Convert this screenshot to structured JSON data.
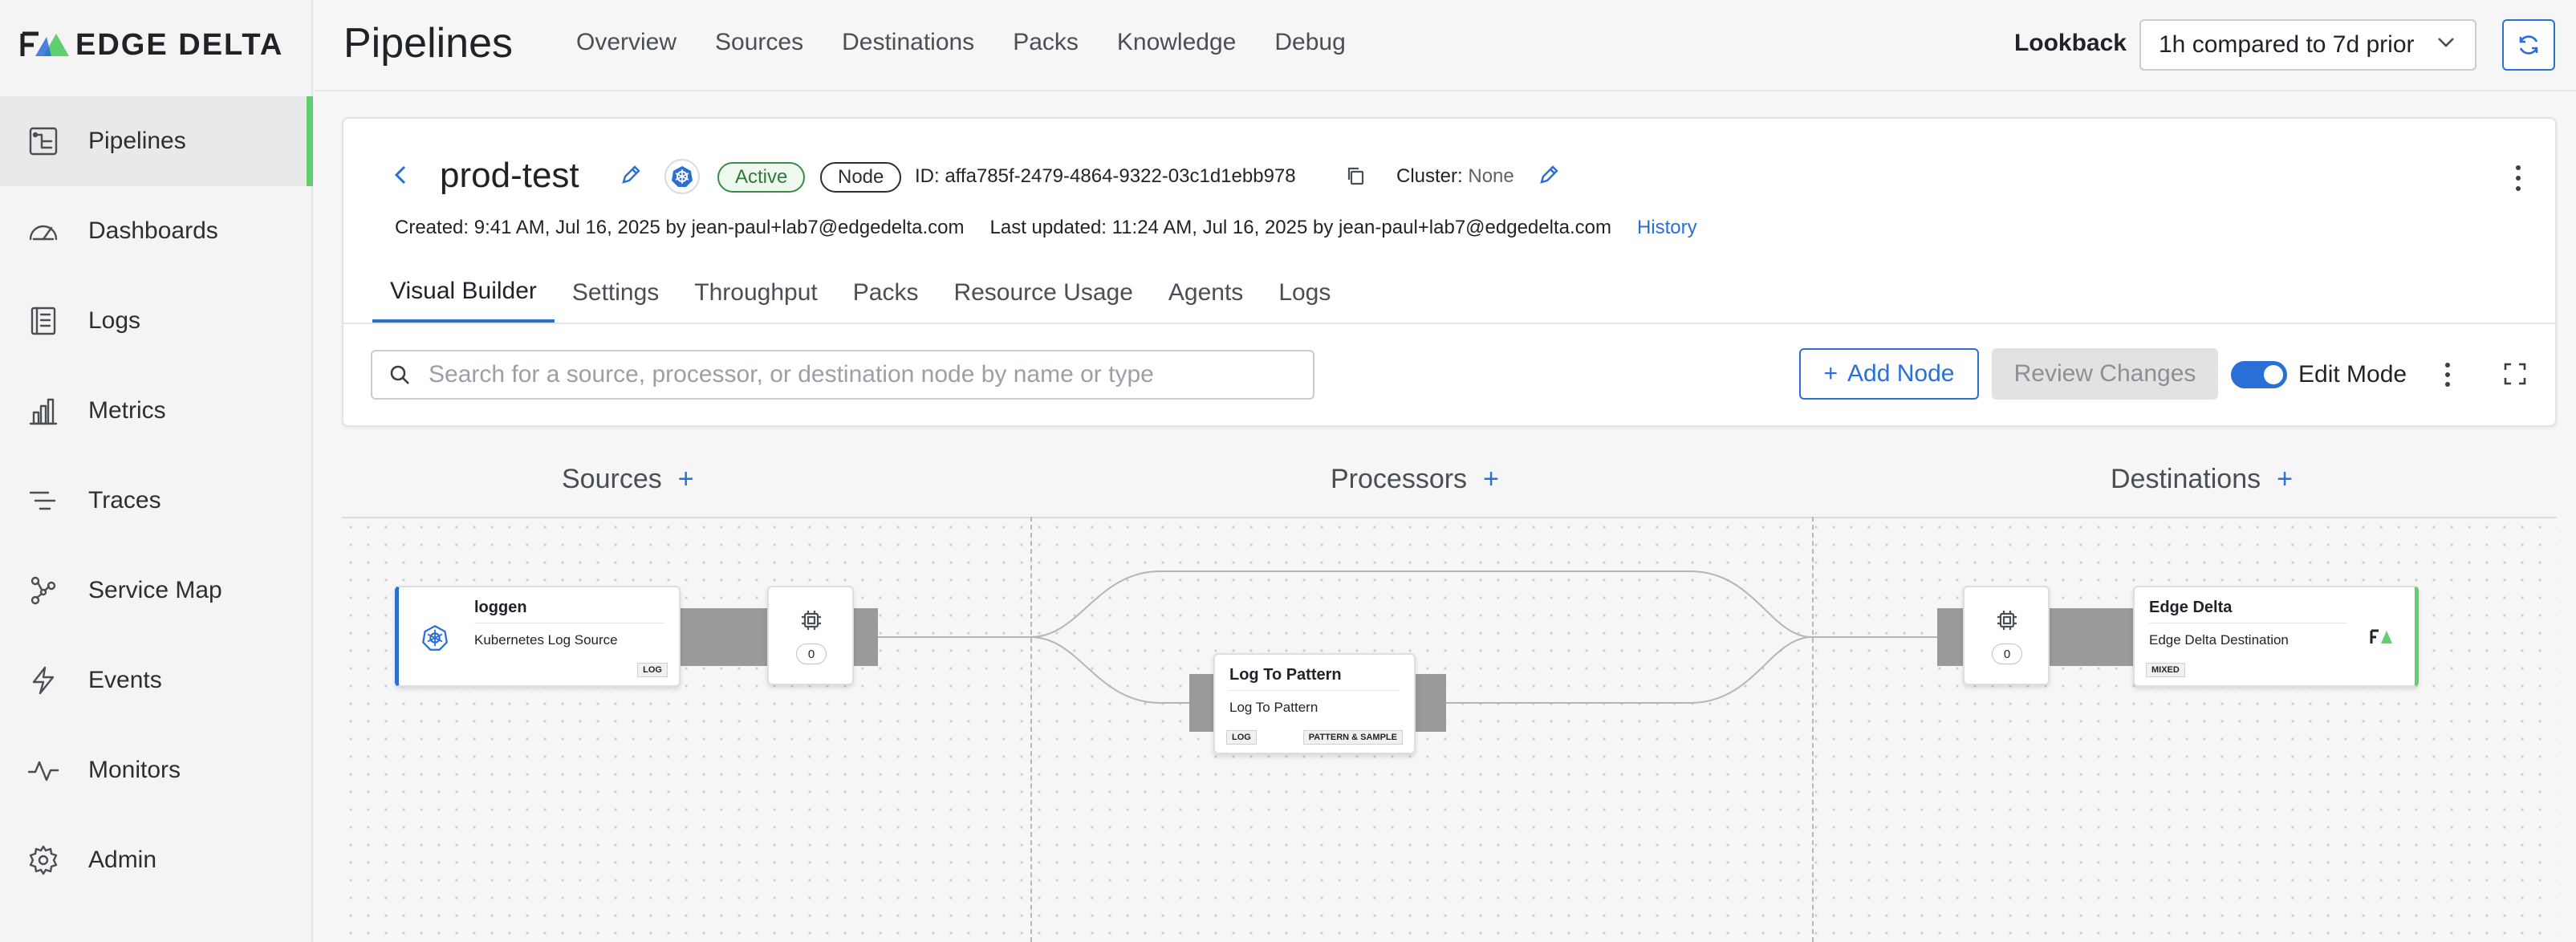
{
  "app": {
    "brand": "EDGE DELTA",
    "brand_color": "#5fcf6f",
    "accent": "#2a6fd6"
  },
  "sidebar": {
    "items": [
      {
        "label": "Pipelines",
        "icon": "pipeline-icon",
        "active": true
      },
      {
        "label": "Dashboards",
        "icon": "gauge-icon"
      },
      {
        "label": "Logs",
        "icon": "logs-icon"
      },
      {
        "label": "Metrics",
        "icon": "bar-chart-icon"
      },
      {
        "label": "Traces",
        "icon": "traces-icon"
      },
      {
        "label": "Service Map",
        "icon": "graph-icon"
      },
      {
        "label": "Events",
        "icon": "lightning-icon"
      },
      {
        "label": "Monitors",
        "icon": "pulse-icon"
      },
      {
        "label": "Admin",
        "icon": "gear-icon"
      }
    ]
  },
  "header": {
    "title": "Pipelines",
    "tabs": [
      "Overview",
      "Sources",
      "Destinations",
      "Packs",
      "Knowledge",
      "Debug"
    ],
    "lookback_label": "Lookback",
    "lookback_value": "1h compared to 7d prior"
  },
  "pipeline": {
    "name": "prod-test",
    "status": "Active",
    "type": "Node",
    "id_text": "ID: affa785f-2479-4864-9322-03c1d1ebb978",
    "cluster_label": "Cluster:",
    "cluster_value": "None",
    "created": "Created: 9:41 AM, Jul 16, 2025 by jean-paul+lab7@edgedelta.com",
    "updated": "Last updated: 11:24 AM, Jul 16, 2025 by jean-paul+lab7@edgedelta.com",
    "history_link": "History"
  },
  "tabs": [
    "Visual Builder",
    "Settings",
    "Throughput",
    "Packs",
    "Resource Usage",
    "Agents",
    "Logs"
  ],
  "active_tab": "Visual Builder",
  "toolbar": {
    "search_placeholder": "Search for a source, processor, or destination node by name or type",
    "add_node": "Add Node",
    "review_changes": "Review Changes",
    "edit_mode": "Edit Mode",
    "edit_mode_on": true
  },
  "canvas": {
    "columns": {
      "sources": "Sources",
      "processors": "Processors",
      "destinations": "Destinations"
    },
    "source_node": {
      "title": "loggen",
      "subtitle": "Kubernetes Log Source",
      "tag": "LOG",
      "accent": "#2a6fd6"
    },
    "source_counter": "0",
    "processor_node": {
      "title": "Log To Pattern",
      "subtitle": "Log To Pattern",
      "tag_left": "LOG",
      "tag_right": "PATTERN & SAMPLE"
    },
    "dest_counter": "0",
    "dest_node": {
      "title": "Edge Delta",
      "subtitle": "Edge Delta Destination",
      "tag": "MIXED",
      "accent": "#5fcf6f"
    }
  }
}
